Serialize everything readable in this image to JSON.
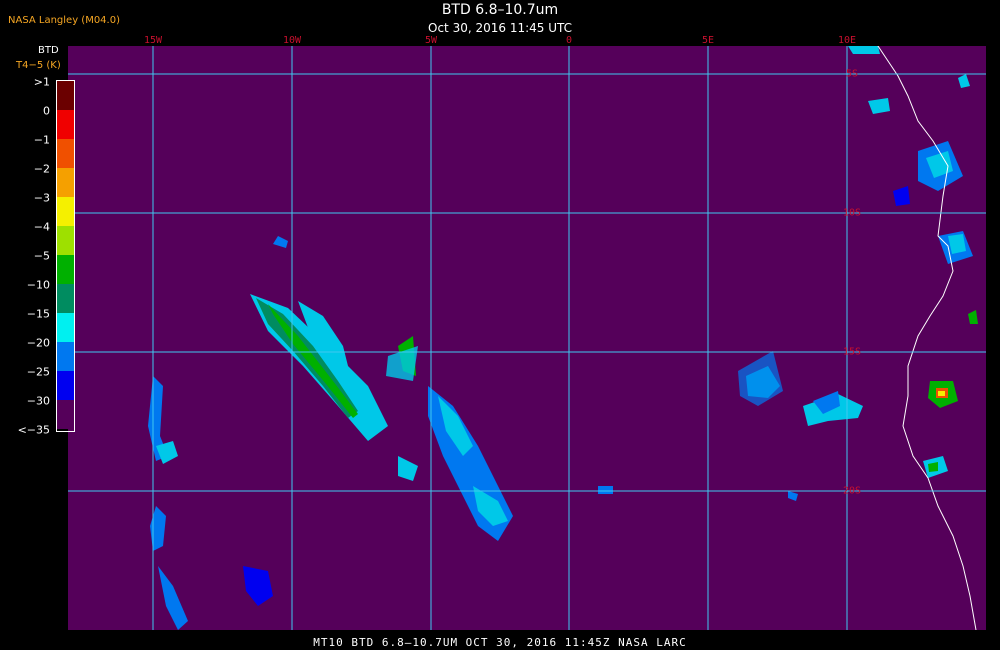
{
  "header": {
    "agency": "NASA Langley (M04.0)",
    "title": "BTD 6.8–10.7um",
    "subtitle": "Oct 30, 2016 11:45 UTC"
  },
  "legend": {
    "title_line1": "BTD",
    "title_line2": "T4−5 (K)",
    "colors": [
      "#6b0000",
      "#f00000",
      "#f05000",
      "#f5a000",
      "#f5f000",
      "#9ee000",
      "#00b000",
      "#008c60",
      "#00f0f0",
      "#0078f0",
      "#0000f0",
      "#55005a"
    ],
    "ticks": [
      ">1",
      "0",
      "−1",
      "−2",
      "−3",
      "−4",
      "−5",
      "−10",
      "−15",
      "−20",
      "−25",
      "−30",
      "<−35"
    ]
  },
  "graticule": {
    "grid_color": "#40c8f0",
    "label_color": "#c8102e",
    "lon_labels": [
      "15W",
      "10W",
      "5W",
      "0",
      "5E",
      "10E"
    ],
    "lat_labels": [
      "5S",
      "10S",
      "15S",
      "20S"
    ]
  },
  "map": {
    "background": "#55005a",
    "coastline_color": "#ffffff"
  },
  "footer": {
    "text": "MT10   BTD 6.8–10.7UM   OCT 30, 2016 11:45Z   NASA LARC"
  }
}
